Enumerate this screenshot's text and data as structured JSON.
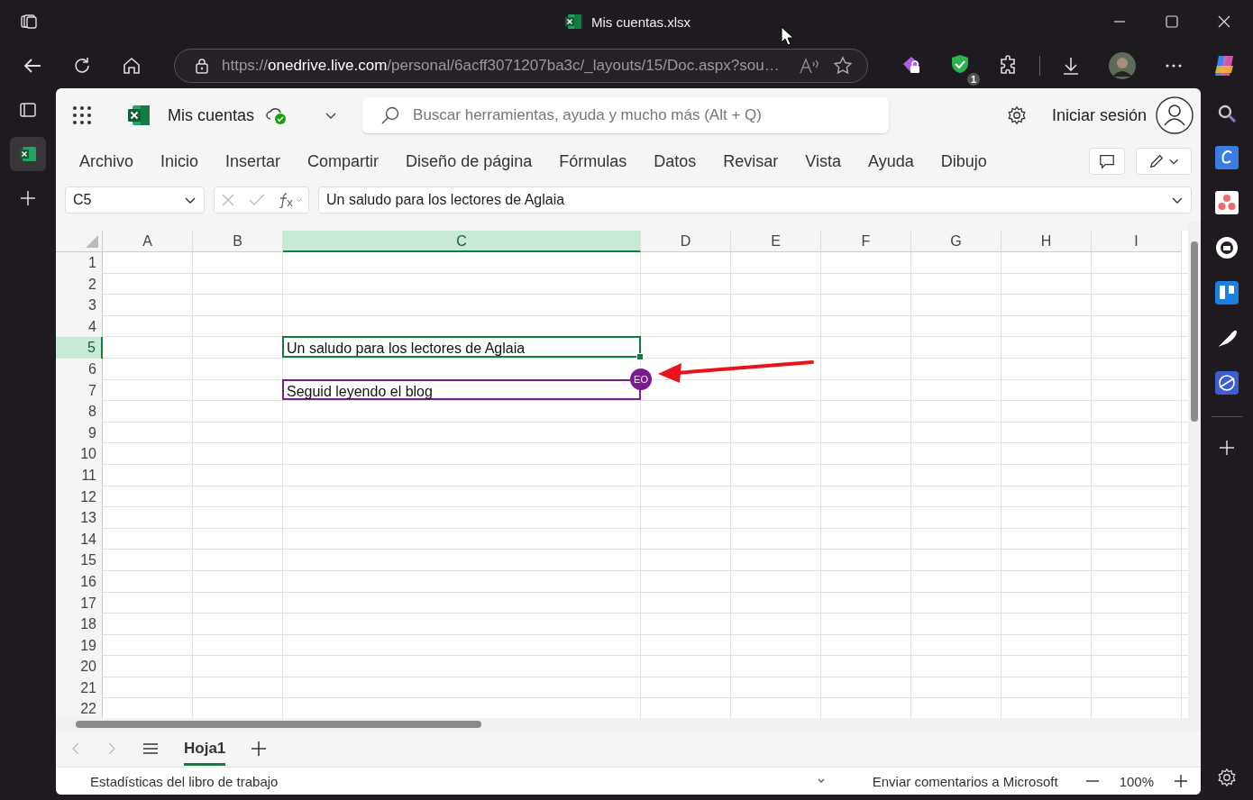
{
  "browser": {
    "title": "Mis cuentas.xlsx",
    "url_scheme": "https://",
    "url_host": "onedrive.live.com",
    "url_path": "/personal/6acff3071207ba3c/_layouts/15/Doc.aspx?sou…",
    "extension_badge": "1"
  },
  "app": {
    "doc_name": "Mis cuentas",
    "search_placeholder": "Buscar herramientas, ayuda y mucho más (Alt + Q)",
    "sign_in": "Iniciar sesión"
  },
  "ribbon_tabs": [
    {
      "label": "Archivo"
    },
    {
      "label": "Inicio"
    },
    {
      "label": "Insertar"
    },
    {
      "label": "Compartir"
    },
    {
      "label": "Diseño de página"
    },
    {
      "label": "Fórmulas"
    },
    {
      "label": "Datos"
    },
    {
      "label": "Revisar"
    },
    {
      "label": "Vista"
    },
    {
      "label": "Ayuda"
    },
    {
      "label": "Dibujo"
    }
  ],
  "formula_bar": {
    "name_box": "C5",
    "formula": "Un saludo para los lectores de Aglaia"
  },
  "grid": {
    "columns": [
      {
        "label": "A",
        "selected": false
      },
      {
        "label": "B",
        "selected": false
      },
      {
        "label": "C",
        "selected": true
      },
      {
        "label": "D",
        "selected": false
      },
      {
        "label": "E",
        "selected": false
      },
      {
        "label": "F",
        "selected": false
      },
      {
        "label": "G",
        "selected": false
      },
      {
        "label": "H",
        "selected": false
      },
      {
        "label": "I",
        "selected": false
      }
    ],
    "rows": [
      {
        "label": "1",
        "selected": false
      },
      {
        "label": "2",
        "selected": false
      },
      {
        "label": "3",
        "selected": false
      },
      {
        "label": "4",
        "selected": false
      },
      {
        "label": "5",
        "selected": true,
        "cells": [
          null,
          null,
          {
            "text": "Un saludo para los lectores de Aglaia",
            "selected": true
          }
        ]
      },
      {
        "label": "6",
        "selected": false
      },
      {
        "label": "7",
        "selected": false,
        "cells": [
          null,
          null,
          {
            "text": "Seguid leyendo el blog",
            "selected": false,
            "collaborator": {
              "initials": "EO",
              "color": "#7a1c8c"
            }
          }
        ]
      },
      {
        "label": "8",
        "selected": false
      },
      {
        "label": "9",
        "selected": false
      },
      {
        "label": "10",
        "selected": false
      },
      {
        "label": "11",
        "selected": false
      },
      {
        "label": "12",
        "selected": false
      },
      {
        "label": "13",
        "selected": false
      },
      {
        "label": "14",
        "selected": false
      },
      {
        "label": "15",
        "selected": false
      },
      {
        "label": "16",
        "selected": false
      },
      {
        "label": "17",
        "selected": false
      },
      {
        "label": "18",
        "selected": false
      },
      {
        "label": "19",
        "selected": false
      },
      {
        "label": "20",
        "selected": false
      },
      {
        "label": "21",
        "selected": false
      },
      {
        "label": "22",
        "selected": false
      }
    ]
  },
  "sheet_tabs": [
    {
      "label": "Hoja1",
      "selected": true
    }
  ],
  "status_bar": {
    "left": "Estadísticas del libro de trabajo",
    "feedback": "Enviar comentarios a Microsoft",
    "zoom": "100%"
  }
}
